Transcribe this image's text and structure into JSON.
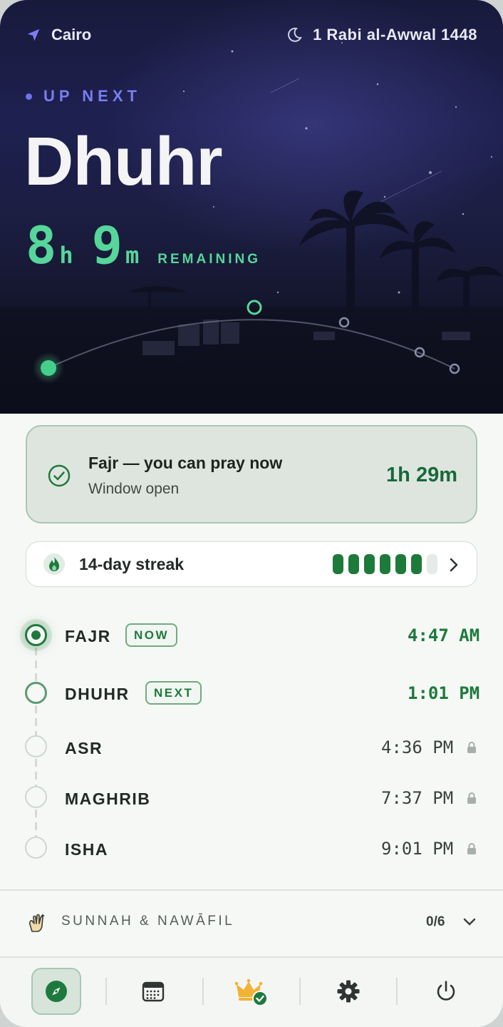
{
  "header": {
    "location": "Cairo",
    "hijri_date": "1 Rabi al-Awwal 1448",
    "icons": [
      "location-arrow-icon",
      "crescent-moon-icon"
    ]
  },
  "hero": {
    "up_next_label": "UP NEXT",
    "prayer_name": "Dhuhr",
    "countdown": {
      "hours": "8",
      "hours_unit": "h",
      "minutes": "9",
      "minutes_unit": "m",
      "label": "REMAINING"
    }
  },
  "window_card": {
    "title": "Fajr — you can pray now",
    "subtitle": "Window open",
    "time_left": "1h 29m"
  },
  "streak": {
    "label": "14-day streak",
    "filled_days": 6,
    "total_days": 7
  },
  "prayers": [
    {
      "name": "FAJR",
      "badge": "NOW",
      "time": "4:47 AM",
      "state": "now",
      "locked": false
    },
    {
      "name": "DHUHR",
      "badge": "NEXT",
      "time": "1:01 PM",
      "state": "next",
      "locked": false
    },
    {
      "name": "ASR",
      "badge": "",
      "time": "4:36 PM",
      "state": "upcoming",
      "locked": true
    },
    {
      "name": "MAGHRIB",
      "badge": "",
      "time": "7:37 PM",
      "state": "upcoming",
      "locked": true
    },
    {
      "name": "ISHA",
      "badge": "",
      "time": "9:01 PM",
      "state": "upcoming",
      "locked": true
    }
  ],
  "sunnah": {
    "label": "SUNNAH & NAWĀFIL",
    "count": "0/6"
  },
  "tabs": [
    {
      "icon": "compass-icon",
      "active": true
    },
    {
      "icon": "calendar-icon",
      "active": false
    },
    {
      "icon": "crown-check-icon",
      "active": false
    },
    {
      "icon": "gear-icon",
      "active": false
    },
    {
      "icon": "power-icon",
      "active": false
    }
  ],
  "colors": {
    "accent_green": "#1e7a3c",
    "countdown_green": "#56d69a",
    "up_next_violet": "#7a7ef0",
    "hero_night": "#1e2050"
  }
}
